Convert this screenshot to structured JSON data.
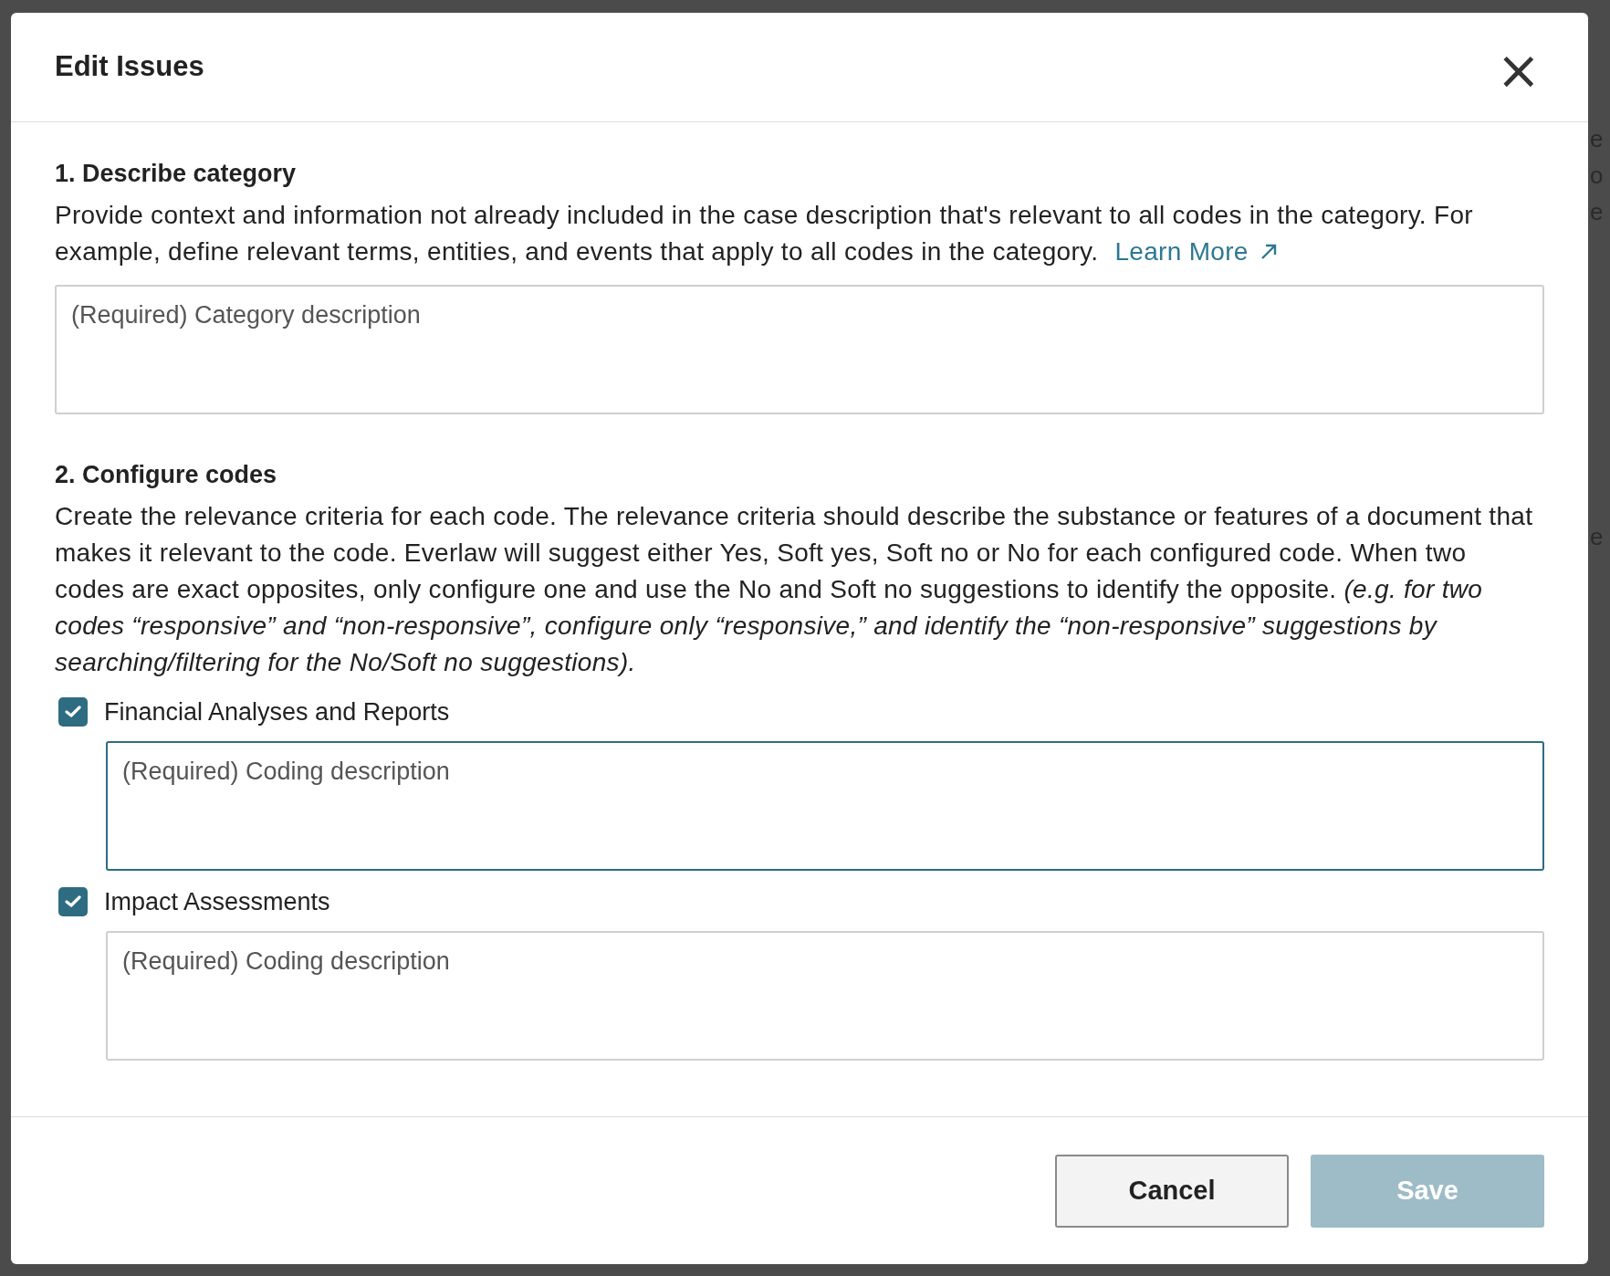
{
  "backdrop": {
    "right_fragments": [
      "e",
      "o",
      "e",
      "e"
    ]
  },
  "dialog": {
    "title": "Edit Issues",
    "close": "×",
    "sections": [
      {
        "heading": "1. Describe category",
        "description": "Provide context and information not already included in the case description that's relevant to all codes in the category. For example, define relevant terms, entities, and events that apply to all codes in the category.",
        "link": "Learn More",
        "field": {
          "placeholder": "(Required) Category description",
          "focused": false
        }
      },
      {
        "heading": "2. Configure codes",
        "description": "Create the relevance criteria for each code. The relevance criteria should describe the substance or features of a document that makes it relevant to the code. Everlaw will suggest either Yes, Soft yes, Soft no or No for each configured code. When two codes are exact opposites, only configure one and use the No and Soft no suggestions to identify the opposite. *(e.g. for two codes “responsive” and “non-responsive”, configure only “responsive,” and identify the “non-responsive” suggestions by searching/filtering for the No/Soft no suggestions).*",
        "codes": [
          {
            "label": "Financial Analyses and Reports",
            "checked": true,
            "field": {
              "placeholder": "(Required) Coding description",
              "focused": true
            }
          },
          {
            "label": "Impact Assessments",
            "checked": true,
            "field": {
              "placeholder": "(Required) Coding description",
              "focused": false
            }
          }
        ]
      }
    ],
    "buttons": [
      {
        "label": "Cancel",
        "kind": "secondary",
        "disabled": false
      },
      {
        "label": "Save",
        "kind": "primary",
        "disabled": true
      }
    ]
  }
}
